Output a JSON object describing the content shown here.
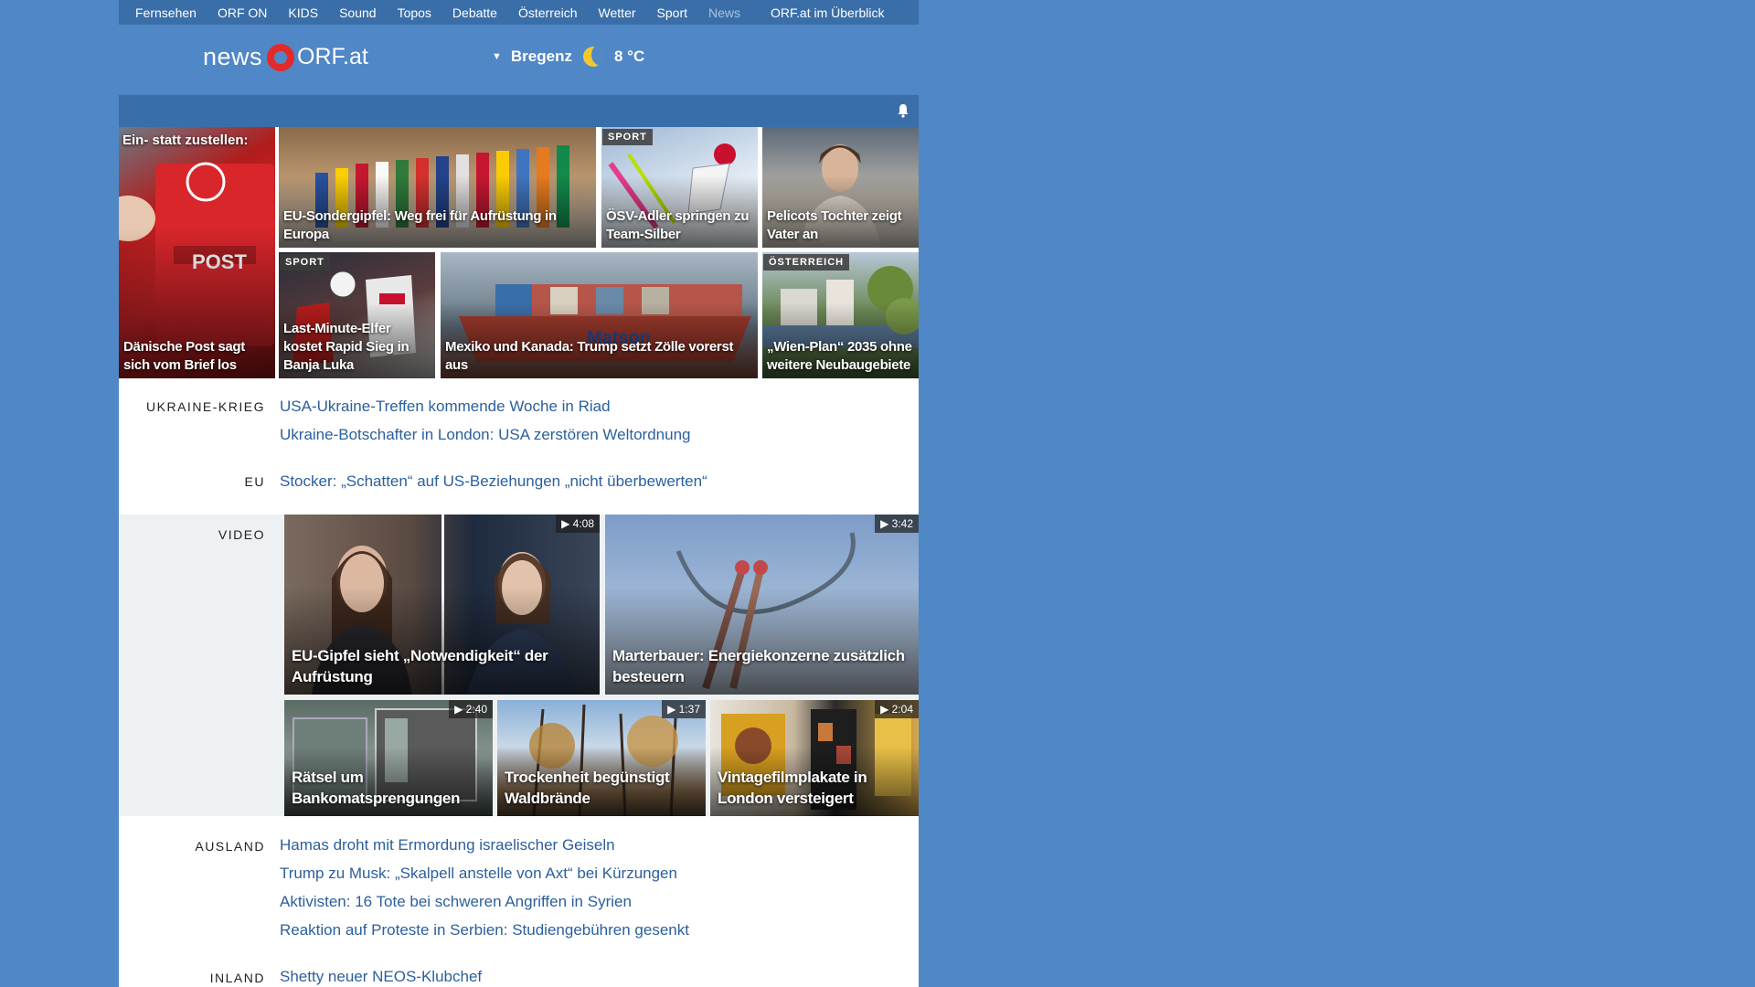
{
  "nav": {
    "items": [
      "Fernsehen",
      "ORF ON",
      "KIDS",
      "Sound",
      "Topos",
      "Debatte",
      "Österreich",
      "Wetter",
      "Sport",
      "News"
    ],
    "current": "News",
    "overview": "ORF.at im Überblick"
  },
  "header": {
    "logo_news": "news",
    "logo_orf": "ORF.at",
    "weather_city": "Bregenz",
    "weather_temp": "8 °C"
  },
  "top_tiles": [
    {
      "caption": "Dänische Post sagt sich vom Brief los",
      "toptext": "Ein- statt zustellen:",
      "badge": ""
    },
    {
      "caption": "EU-Sondergipfel: Weg frei für Aufrüstung in Europa",
      "badge": ""
    },
    {
      "caption": "ÖSV-Adler springen zu Team-Silber",
      "badge": "SPORT"
    },
    {
      "caption": "Pelicots Tochter zeigt Vater an",
      "badge": ""
    },
    {
      "caption": "Last-Minute-Elfer kostet Rapid Sieg in Banja Luka",
      "badge": "SPORT"
    },
    {
      "caption": "Mexiko und Kanada: Trump setzt Zölle vorerst aus",
      "badge": ""
    },
    {
      "caption": "„Wien-Plan“ 2035 ohne weitere Neubaugebiete",
      "badge": "ÖSTERREICH"
    }
  ],
  "sections": {
    "ukraine": {
      "label": "UKRAINE-KRIEG",
      "links": [
        "USA-Ukraine-Treffen kommende Woche in Riad",
        "Ukraine-Botschafter in London: USA zerstören Weltordnung"
      ]
    },
    "eu": {
      "label": "EU",
      "links": [
        "Stocker: „Schatten“ auf US-Beziehungen „nicht überbewerten“"
      ]
    },
    "video": {
      "label": "VIDEO"
    },
    "ausland": {
      "label": "AUSLAND",
      "links": [
        "Hamas droht mit Ermordung israelischer Geiseln",
        "Trump zu Musk: „Skalpell anstelle von Axt“ bei Kürzungen",
        "Aktivisten: 16 Tote bei schweren Angriffen in Syrien",
        "Reaktion auf Proteste in Serbien: Studiengebühren gesenkt"
      ]
    },
    "inland": {
      "label": "INLAND",
      "links": [
        "Shetty neuer NEOS-Klubchef"
      ]
    }
  },
  "videos": [
    {
      "caption": "EU-Gipfel sieht „Notwendigkeit“ der Aufrüstung",
      "duration": "4:08"
    },
    {
      "caption": "Marterbauer: Energiekonzerne zusätzlich besteuern",
      "duration": "3:42"
    },
    {
      "caption": "Rätsel um Bankomatsprengungen",
      "duration": "2:40"
    },
    {
      "caption": "Trockenheit begünstigt Waldbrände",
      "duration": "1:37"
    },
    {
      "caption": "Vintagefilmplakate in London versteigert",
      "duration": "2:04"
    }
  ],
  "colors": {
    "background": "#5087c6",
    "nav": "#3a6ea8",
    "link": "#2b5f9c",
    "logo_red": "#e22a2a"
  }
}
